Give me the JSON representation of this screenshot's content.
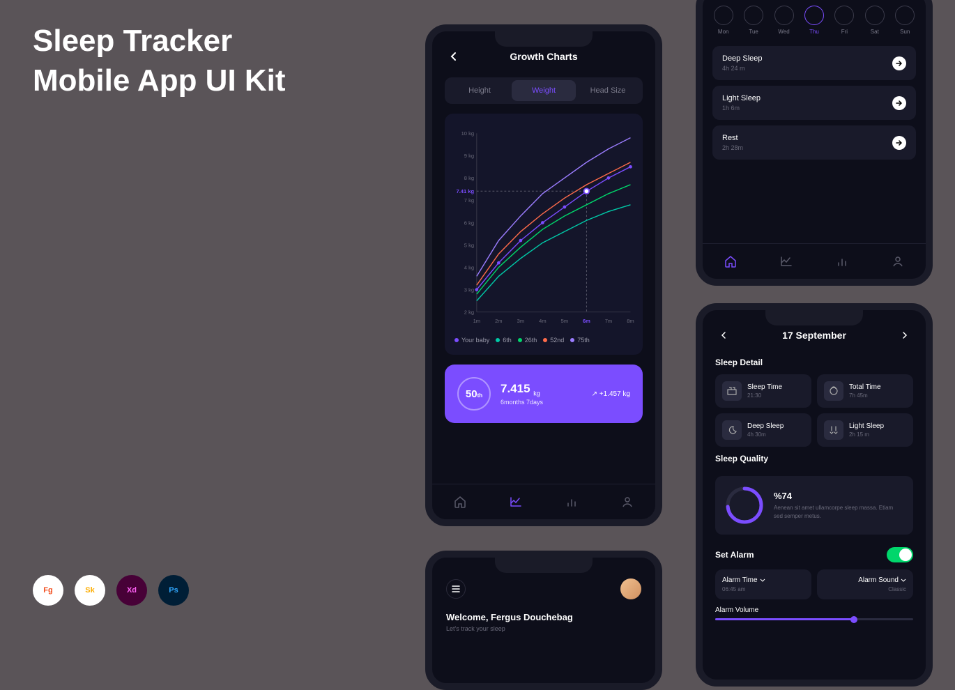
{
  "title_line1": "Sleep Tracker",
  "title_line2": "Mobile App UI Kit",
  "tools": [
    "Fg",
    "Sk",
    "Xd",
    "Ps"
  ],
  "phone1": {
    "title": "Growth Charts",
    "tabs": [
      "Height",
      "Weight",
      "Head Size"
    ],
    "active_tab": 1,
    "highlight_value": "7.41 kg",
    "legend": [
      {
        "label": "Your baby",
        "color": "#7b4dff"
      },
      {
        "label": "6th",
        "color": "#00c9a7"
      },
      {
        "label": "26th",
        "color": "#00d66b"
      },
      {
        "label": "52nd",
        "color": "#ff6b4a"
      },
      {
        "label": "75th",
        "color": "#9b7dff"
      }
    ],
    "summary": {
      "percentile": "50",
      "percentile_suffix": "th",
      "value": "7.415",
      "unit": "kg",
      "age": "6months 7days",
      "delta": "↗ +1.457 kg"
    }
  },
  "phone2": {
    "days": [
      "Mon",
      "Tue",
      "Wed",
      "Thu",
      "Fri",
      "Sat",
      "Sun"
    ],
    "active_day": 3,
    "cards": [
      {
        "title": "Deep Sleep",
        "sub": "4h 24 m"
      },
      {
        "title": "Light Sleep",
        "sub": "1h 6m"
      },
      {
        "title": "Rest",
        "sub": "2h 28m"
      }
    ]
  },
  "phone3": {
    "welcome": "Welcome, Fergus Douchebag",
    "sub": "Let's track your sleep"
  },
  "phone4": {
    "date": "17 September",
    "detail_title": "Sleep Detail",
    "details": [
      {
        "title": "Sleep Time",
        "sub": "21:30"
      },
      {
        "title": "Total Time",
        "sub": "7h 45m"
      },
      {
        "title": "Deep Sleep",
        "sub": "4h 30m"
      },
      {
        "title": "Light Sleep",
        "sub": "2h 15 m"
      }
    ],
    "quality_title": "Sleep Quality",
    "quality_pct": "%74",
    "quality_desc": "Aenean sit amet ullamcorpe sleep massa. Etiam sed semper metus.",
    "alarm_title": "Set Alarm",
    "alarm_time_label": "Alarm Time",
    "alarm_time": "06:45 am",
    "alarm_sound_label": "Alarm Sound",
    "alarm_sound": "Classic",
    "volume_label": "Alarm Volume"
  },
  "chart_data": {
    "type": "line",
    "xlabel": "months",
    "ylabel": "kg",
    "x_ticks": [
      "1m",
      "2m",
      "3m",
      "4m",
      "5m",
      "6m",
      "7m",
      "8m"
    ],
    "y_ticks": [
      "2 kg",
      "3 kg",
      "4 kg",
      "5 kg",
      "6 kg",
      "7 kg",
      "8 kg",
      "9 kg",
      "10 kg"
    ],
    "ylim": [
      2,
      10
    ],
    "highlight_x": "6m",
    "highlight_y": 7.41,
    "series": [
      {
        "name": "Your baby",
        "color": "#7b4dff",
        "values": [
          3.0,
          4.2,
          5.2,
          6.0,
          6.7,
          7.4,
          8.0,
          8.5
        ]
      },
      {
        "name": "6th",
        "color": "#00c9a7",
        "values": [
          2.5,
          3.6,
          4.4,
          5.1,
          5.6,
          6.1,
          6.5,
          6.8
        ]
      },
      {
        "name": "26th",
        "color": "#00d66b",
        "values": [
          2.8,
          4.0,
          4.9,
          5.7,
          6.3,
          6.8,
          7.3,
          7.7
        ]
      },
      {
        "name": "52nd",
        "color": "#ff6b4a",
        "values": [
          3.2,
          4.6,
          5.6,
          6.4,
          7.1,
          7.7,
          8.2,
          8.7
        ]
      },
      {
        "name": "75th",
        "color": "#9b7dff",
        "values": [
          3.6,
          5.2,
          6.3,
          7.3,
          8.0,
          8.7,
          9.3,
          9.8
        ]
      }
    ]
  }
}
